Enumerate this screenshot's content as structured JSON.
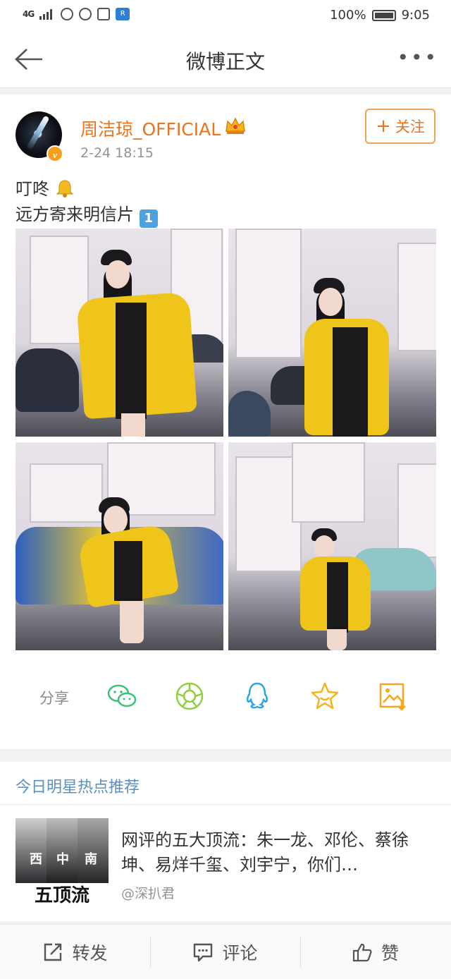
{
  "status_bar": {
    "network": "4G",
    "battery_percent": "100%",
    "time": "9:05"
  },
  "nav": {
    "title": "微博正文"
  },
  "post": {
    "author": "周洁琼_OFFICIAL",
    "timestamp": "2-24 18:15",
    "follow_label": "关注",
    "line1": "叮咚",
    "line2": "远方寄来明信片",
    "line2_emoji": "1",
    "photo_count": 4
  },
  "share": {
    "label": "分享",
    "targets": [
      "wechat-icon",
      "moments-icon",
      "qq-icon",
      "favorite-icon",
      "save-image-icon"
    ]
  },
  "hot": {
    "section_title": "今日明星热点推荐",
    "item": {
      "title": "网评的五大顶流：朱一龙、邓伦、蔡徐坤、易烊千玺、刘宇宁，你们…",
      "source": "@深扒君",
      "thumb_caption": "五顶流",
      "thumb_tags": [
        "西",
        "中",
        "南"
      ]
    }
  },
  "bottom_bar": {
    "repost": "转发",
    "comment": "评论",
    "like": "赞"
  },
  "colors": {
    "accent_orange": "#eb7319",
    "link_blue": "#5b8fc0",
    "coat_yellow": "#f0c51b"
  }
}
